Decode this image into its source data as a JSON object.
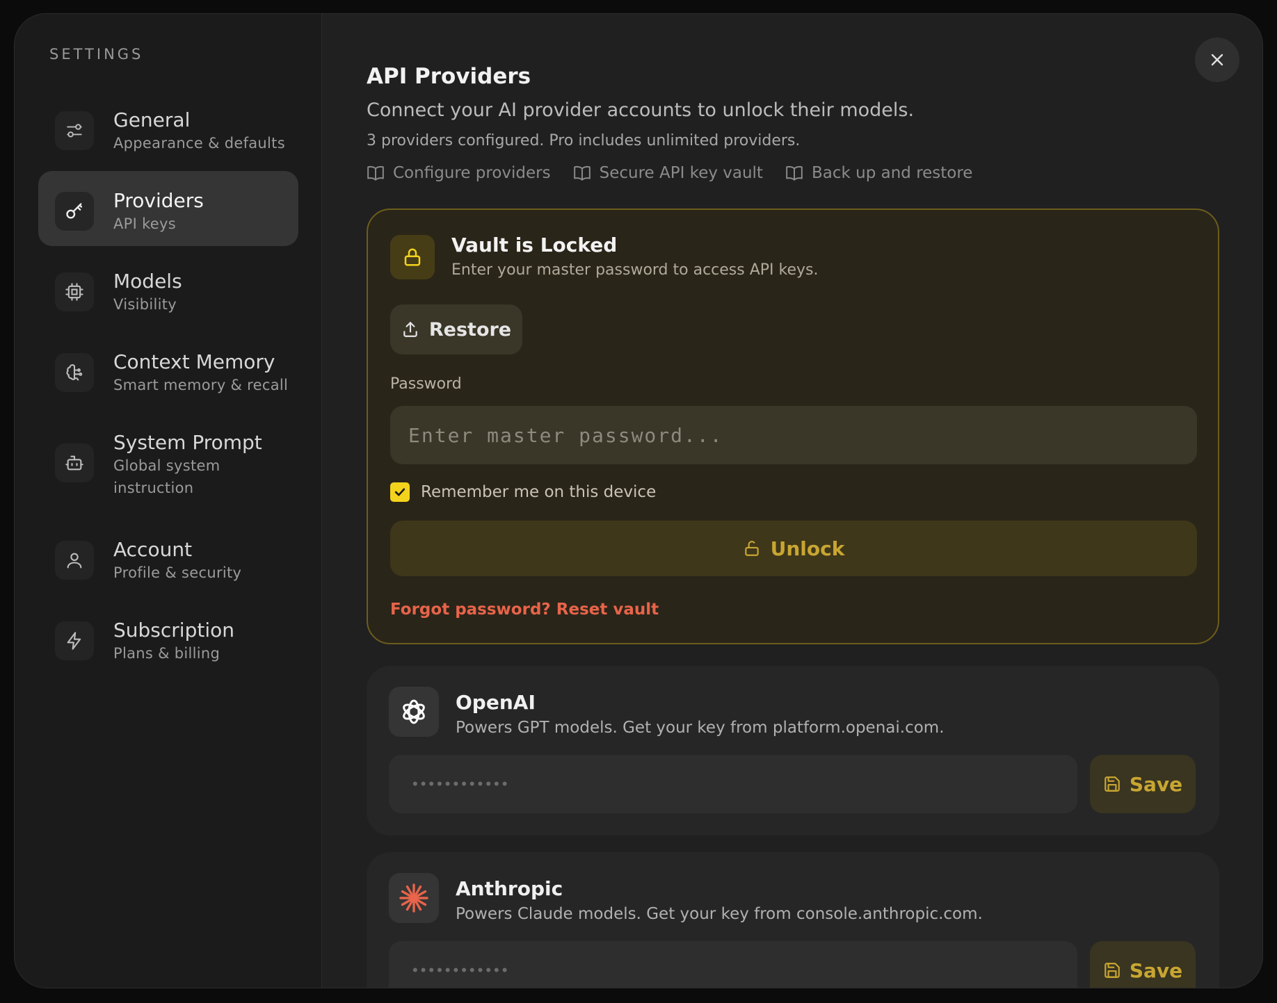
{
  "sidebar": {
    "title": "SETTINGS",
    "items": [
      {
        "label": "General",
        "sub": "Appearance & defaults",
        "icon": "sliders-icon"
      },
      {
        "label": "Providers",
        "sub": "API keys",
        "icon": "key-icon",
        "active": true
      },
      {
        "label": "Models",
        "sub": "Visibility",
        "icon": "cpu-icon"
      },
      {
        "label": "Context Memory",
        "sub": "Smart memory & recall",
        "icon": "brain-icon"
      },
      {
        "label": "System Prompt",
        "sub": "Global system instruction",
        "icon": "bot-icon"
      },
      {
        "label": "Account",
        "sub": "Profile & security",
        "icon": "user-icon"
      },
      {
        "label": "Subscription",
        "sub": "Plans & billing",
        "icon": "lightning-icon"
      }
    ]
  },
  "header": {
    "title": "API Providers",
    "description": "Connect your AI provider accounts to unlock their models.",
    "note": "3 providers configured. Pro includes unlimited providers.",
    "links": [
      "Configure providers",
      "Secure API key vault",
      "Back up and restore"
    ]
  },
  "vault": {
    "title": "Vault is Locked",
    "subtitle": "Enter your master password to access API keys.",
    "restore_label": "Restore",
    "password_label": "Password",
    "password_placeholder": "Enter master password...",
    "remember_label": "Remember me on this device",
    "remember_checked": true,
    "unlock_label": "Unlock",
    "forgot_label": "Forgot password? Reset vault",
    "accent_color": "#f4d31c",
    "danger_color": "#e8644a"
  },
  "providers": [
    {
      "name": "OpenAI",
      "description": "Powers GPT models. Get your key from platform.openai.com.",
      "key_placeholder": "••••••••••••",
      "save_label": "Save",
      "icon": "openai-logo-icon"
    },
    {
      "name": "Anthropic",
      "description": "Powers Claude models. Get your key from console.anthropic.com.",
      "key_placeholder": "••••••••••••",
      "save_label": "Save",
      "icon": "anthropic-logo-icon",
      "brand_color": "#e8644a"
    }
  ]
}
